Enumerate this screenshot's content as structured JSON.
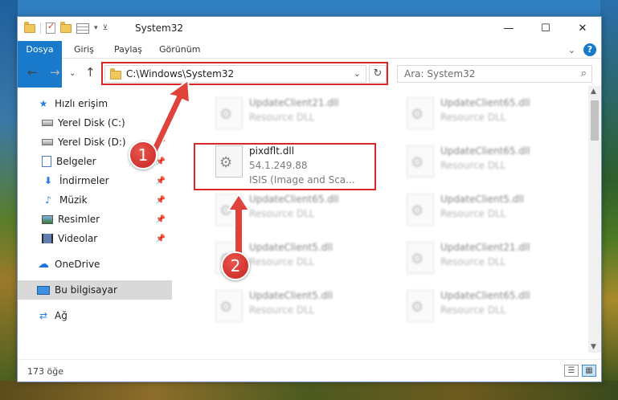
{
  "window": {
    "title": "System32",
    "controls": {
      "minimize": "—",
      "maximize": "☐",
      "close": "✕"
    }
  },
  "ribbon": {
    "tabs": [
      "Dosya",
      "Giriş",
      "Paylaş",
      "Görünüm"
    ],
    "collapse": "⌄",
    "help": "?"
  },
  "nav": {
    "back": "←",
    "forward": "→",
    "recent": "⌄",
    "up": "↑",
    "address": "C:\\Windows\\System32",
    "address_dropdown": "⌄",
    "refresh": "↻",
    "search_placeholder": "Ara: System32",
    "search_icon": "⌕"
  },
  "sidebar": {
    "items": [
      {
        "label": "Hızlı erişim",
        "icon": "star-icon",
        "glyph": "★"
      },
      {
        "label": "Yerel Disk (C:)",
        "icon": "disk-icon"
      },
      {
        "label": "Yerel Disk (D:)",
        "icon": "disk-icon"
      },
      {
        "label": "Belgeler",
        "icon": "document-icon"
      },
      {
        "label": "İndirmeler",
        "icon": "download-icon",
        "glyph": "⬇"
      },
      {
        "label": "Müzik",
        "icon": "music-icon",
        "glyph": "♪"
      },
      {
        "label": "Resimler",
        "icon": "pictures-icon"
      },
      {
        "label": "Videolar",
        "icon": "videos-icon"
      },
      {
        "label": "OneDrive",
        "icon": "cloud-icon",
        "glyph": "☁"
      },
      {
        "label": "Bu bilgisayar",
        "icon": "computer-icon"
      },
      {
        "label": "Ağ",
        "icon": "network-icon",
        "glyph": "⇄"
      }
    ],
    "pin": "📌"
  },
  "files": [
    {
      "name": "UpdateClient21.dll",
      "type": "Resource DLL"
    },
    {
      "name": "UpdateClient65.dll",
      "type": "Resource DLL"
    },
    {
      "name": "pixdflt.dll",
      "version": "54.1.249.88",
      "description": "ISIS (Image and Sca..."
    },
    {
      "name": "UpdateClient65.dll",
      "type": "Resource DLL"
    },
    {
      "name": "UpdateClient65.dll",
      "type": "Resource DLL"
    },
    {
      "name": "UpdateClient5.dll",
      "type": "Resource DLL"
    },
    {
      "name": "UpdateClient5.dll",
      "type": "Resource DLL"
    },
    {
      "name": "UpdateClient21.dll",
      "type": "Resource DLL"
    },
    {
      "name": "UpdateClient5.dll",
      "type": "Resource DLL"
    },
    {
      "name": "UpdateClient65.dll",
      "type": "Resource DLL"
    }
  ],
  "gear_glyph": "⚙",
  "status": {
    "count": "173 öğe"
  },
  "callouts": [
    "1",
    "2"
  ],
  "colors": {
    "accent": "#1979ca",
    "highlight": "#d8262a",
    "selected": "#d9d9d9"
  }
}
